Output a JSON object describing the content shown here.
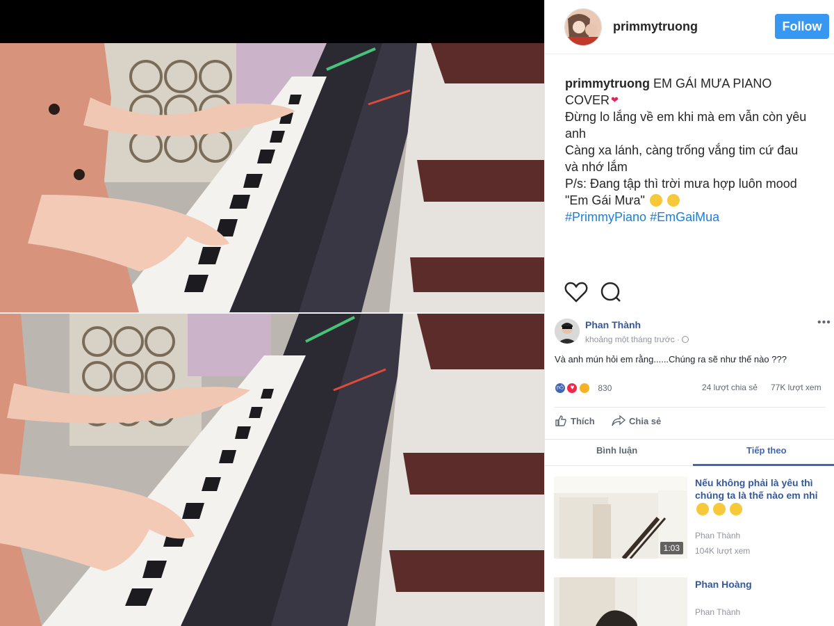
{
  "instagram": {
    "username": "primmytruong",
    "follow_label": "Follow",
    "caption": {
      "username": "primmytruong",
      "line1": "EM GÁI MƯA PIANO",
      "line2": "COVER",
      "line3": "Đừng lo lắng về em khi mà em vẫn còn yêu",
      "line4": "anh",
      "line5": "Càng xa lánh, càng trống vắng tim cứ đau",
      "line6": "và nhớ lắm",
      "line7": "P/s: Đang tập thì trời mưa hợp luôn mood",
      "line8": "\"Em Gái Mưa\"",
      "hashtag1": "#PrimmyPiano",
      "hashtag2": "#EmGaiMua"
    },
    "icons": [
      "heart-icon",
      "comment-icon"
    ]
  },
  "facebook": {
    "author": "Phan Thành",
    "time": "khoảng một tháng trước · ",
    "post_text": "Và anh mún hỏi em rằng......Chúng ra sẽ như thế nào ???",
    "reaction_count": "830",
    "shares": "24 lượt chia sẻ",
    "views": "77K lượt xem",
    "like_label": "Thích",
    "share_label": "Chia sẻ",
    "tab_comments": "Bình luận",
    "tab_next": "Tiếp theo",
    "suggested": [
      {
        "title": "Nếu không phải là yêu thì chúng ta là thế nào em nhỉ",
        "author": "Phan Thành",
        "views": "104K lượt xem",
        "duration": "1:03"
      },
      {
        "title": "Phan Hoàng",
        "author": "Phan Thành",
        "views": "",
        "duration": ""
      }
    ],
    "colors": {
      "link": "#365899",
      "accent": "#4267b2",
      "muted": "#90949c"
    }
  },
  "colors": {
    "follow_button": "#3897f0",
    "hashtag": "#1d7fd8"
  }
}
